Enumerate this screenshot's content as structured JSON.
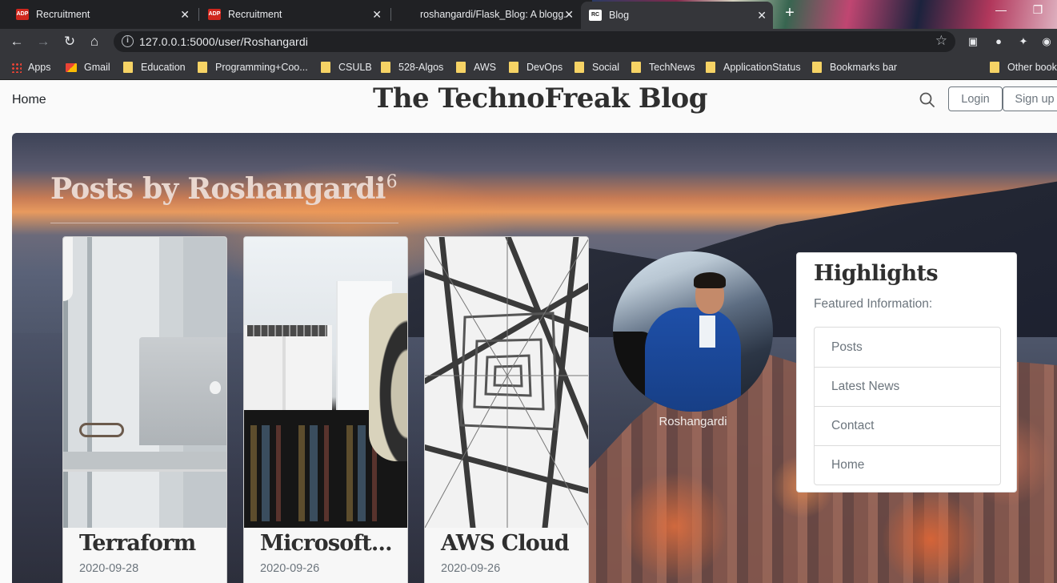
{
  "browser": {
    "tabs": [
      {
        "title": "Recruitment",
        "favicon": "adp-icon"
      },
      {
        "title": "Recruitment",
        "favicon": "adp-icon"
      },
      {
        "title": "roshangardi/Flask_Blog: A blogg...",
        "favicon": "github-icon"
      },
      {
        "title": "Blog",
        "favicon": "rc-icon",
        "active": true
      }
    ],
    "url": "127.0.0.1:5000/user/Roshangardi",
    "bookmarks": [
      "Apps",
      "Gmail",
      "Education",
      "Programming+Coo...",
      "CSULB",
      "528-Algos",
      "AWS",
      "DevOps",
      "Social",
      "TechNews",
      "ApplicationStatus",
      "Bookmarks bar"
    ],
    "other_bookmarks": "Other book"
  },
  "header": {
    "home_link": "Home",
    "title": "The TechnoFreak Blog",
    "login_label": "Login",
    "signup_label": "Sign up"
  },
  "posts_section": {
    "title": "Posts by Roshangardi",
    "count": "6"
  },
  "posts": [
    {
      "title": "Terraform",
      "date": "2020-09-28"
    },
    {
      "title": "Microsoft...",
      "date": "2020-09-26"
    },
    {
      "title": "AWS Cloud",
      "date": "2020-09-26"
    }
  ],
  "profile": {
    "username": "Roshangardi"
  },
  "highlights": {
    "title": "Highlights",
    "subtitle": "Featured Information:",
    "items": [
      "Posts",
      "Latest News",
      "Contact",
      "Home"
    ]
  },
  "colors": {
    "chrome_dark": "#202124",
    "chrome_toolbar": "#35363a",
    "page_bg": "#fafafa",
    "heading": "#2f2f2f",
    "muted": "#6c757d"
  }
}
